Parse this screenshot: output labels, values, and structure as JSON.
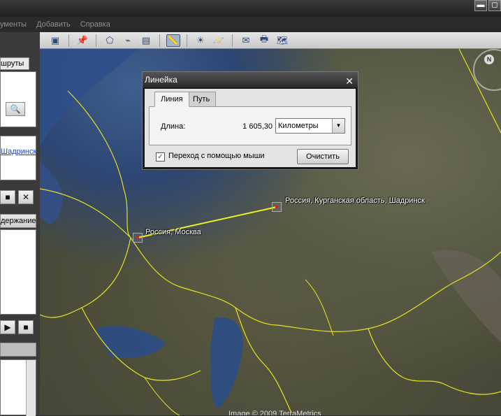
{
  "window": {
    "buttons": [
      "▬",
      "◻"
    ]
  },
  "menu": {
    "items": [
      "ументы",
      "Добавить",
      "Справка"
    ]
  },
  "left_panel": {
    "routes_tab": "шруты",
    "link": "Шадринск",
    "content_header": "держание",
    "buttons": {
      "search": "🔍",
      "stop": "■",
      "close": "✕",
      "play": "▶",
      "stop2": "■"
    }
  },
  "ruler": {
    "title": "Линейка",
    "close": "✕",
    "tabs": [
      "Линия",
      "Путь"
    ],
    "length_label": "Длина:",
    "length_value": "1 605,30",
    "unit": "Километры",
    "checkbox_label": "Переход с помощью мыши",
    "checkbox_checked": true,
    "clear_button": "Очистить"
  },
  "map": {
    "places": [
      {
        "name": "Россия, Москва"
      },
      {
        "name": "Россия, Курганская область, Шадринск"
      }
    ],
    "compass": "N",
    "copyright": "Image © 2009 TerraMetrics",
    "line_color": "#f0f020"
  }
}
